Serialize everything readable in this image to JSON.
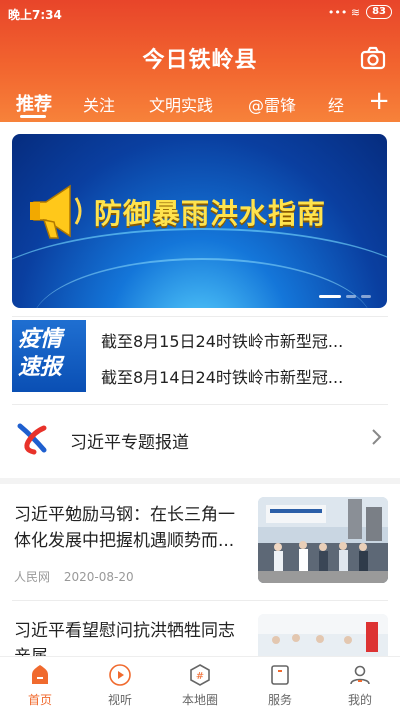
{
  "status": {
    "time": "晚上7:34",
    "indicators": "••• ≋",
    "battery": "83"
  },
  "header": {
    "brand": "今日铁岭县"
  },
  "tabs": [
    {
      "label": "推荐",
      "active": true
    },
    {
      "label": "关注"
    },
    {
      "label": "文明实践"
    },
    {
      "label": "@雷锋"
    },
    {
      "label": "经"
    }
  ],
  "banner": {
    "title": "防御暴雨洪水指南",
    "dots": 3,
    "active_dot": 0
  },
  "epidemic": {
    "badge_line1": "疫情",
    "badge_line2": "速报",
    "items": [
      "截至8月15日24时铁岭市新型冠...",
      "截至8月14日24时铁岭市新型冠..."
    ]
  },
  "special": {
    "label": "习近平专题报道"
  },
  "news": [
    {
      "title": "习近平勉励马钢：在长三角一体化发展中把握机遇顺势而...",
      "source": "人民网",
      "date": "2020-08-20"
    },
    {
      "title": "习近平看望慰问抗洪牺牲同志亲属",
      "source": "",
      "date": ""
    }
  ],
  "nav": [
    {
      "label": "首页",
      "icon": "home-icon",
      "active": true
    },
    {
      "label": "视听",
      "icon": "play-icon"
    },
    {
      "label": "本地圈",
      "icon": "hashtag-icon"
    },
    {
      "label": "服务",
      "icon": "service-icon"
    },
    {
      "label": "我的",
      "icon": "user-icon"
    }
  ],
  "colors": {
    "accent": "#f06a2e",
    "header_top": "#e8452a",
    "header_bottom": "#f7823a",
    "banner_text": "#ffe34d"
  }
}
